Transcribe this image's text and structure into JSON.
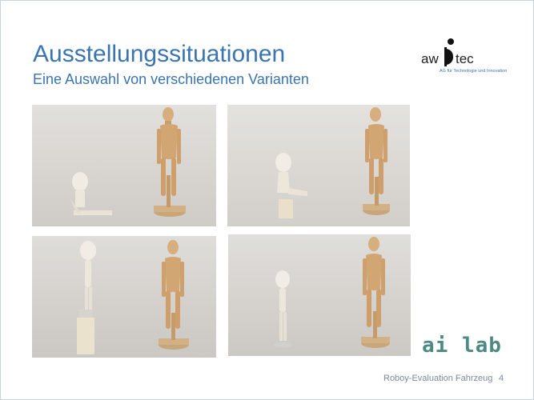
{
  "slide": {
    "title": "Ausstellungssituationen",
    "subtitle": "Eine Auswahl von verschiedenen Varianten"
  },
  "logo": {
    "left_text": "aw",
    "right_text": "tec",
    "tagline": "AG für Technologie und Innovation"
  },
  "photos": [
    "kneeling-small-figure-beside-tall-figure",
    "seated-small-figure-on-block-beside-tall-figure",
    "standing-small-figure-on-pedestal-beside-tall-figure",
    "standing-small-figure-beside-tall-figure"
  ],
  "brand": {
    "ailab": "ai lab"
  },
  "footer": {
    "text": "Roboy-Evaluation Fahrzeug",
    "page": "4"
  },
  "colors": {
    "heading": "#3a75b0",
    "ailab": "#4e8a84",
    "footer": "#7a8a99"
  }
}
